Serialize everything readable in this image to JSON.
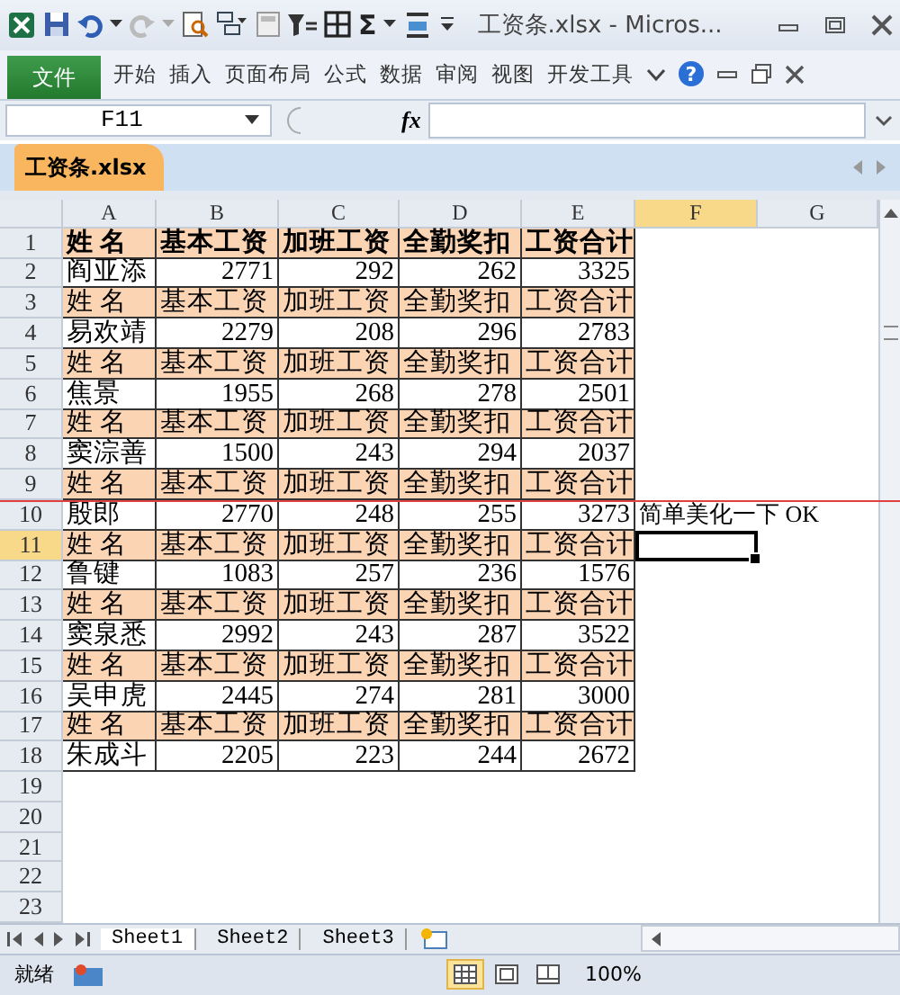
{
  "window": {
    "title": "工资条.xlsx - Micros..."
  },
  "quick_access": {
    "sum_symbol": "Σ"
  },
  "ribbon": {
    "file_tab": "文件",
    "tabs": [
      "开始",
      "插入",
      "页面布局",
      "公式",
      "数据",
      "审阅",
      "视图",
      "开发工具"
    ],
    "help": "?"
  },
  "formula_bar": {
    "name_box": "F11",
    "function_label": "fx"
  },
  "workbook_tab": {
    "label": "工资条.xlsx"
  },
  "columns": [
    {
      "label": "A",
      "selected": false
    },
    {
      "label": "B",
      "selected": false
    },
    {
      "label": "C",
      "selected": false
    },
    {
      "label": "D",
      "selected": false
    },
    {
      "label": "E",
      "selected": false
    },
    {
      "label": "F",
      "selected": true
    },
    {
      "label": "G",
      "selected": false
    }
  ],
  "rows": [
    {
      "number": "1",
      "kind": "title",
      "selected": false,
      "cells": [
        "姓 名",
        "基本工资",
        "加班工资",
        "全勤奖扣",
        "工资合计"
      ]
    },
    {
      "number": "2",
      "kind": "data",
      "selected": false,
      "cells": [
        "阎亚添",
        "2771",
        "292",
        "262",
        "3325"
      ]
    },
    {
      "number": "3",
      "kind": "header",
      "selected": false,
      "cells": [
        "姓 名",
        "基本工资",
        "加班工资",
        "全勤奖扣",
        "工资合计"
      ]
    },
    {
      "number": "4",
      "kind": "data",
      "selected": false,
      "cells": [
        "易欢靖",
        "2279",
        "208",
        "296",
        "2783"
      ]
    },
    {
      "number": "5",
      "kind": "header",
      "selected": false,
      "cells": [
        "姓 名",
        "基本工资",
        "加班工资",
        "全勤奖扣",
        "工资合计"
      ]
    },
    {
      "number": "6",
      "kind": "data",
      "selected": false,
      "cells": [
        "焦景",
        "1955",
        "268",
        "278",
        "2501"
      ]
    },
    {
      "number": "7",
      "kind": "header",
      "selected": false,
      "cells": [
        "姓 名",
        "基本工资",
        "加班工资",
        "全勤奖扣",
        "工资合计"
      ]
    },
    {
      "number": "8",
      "kind": "data",
      "selected": false,
      "cells": [
        "窦淙善",
        "1500",
        "243",
        "294",
        "2037"
      ]
    },
    {
      "number": "9",
      "kind": "header",
      "selected": false,
      "cells": [
        "姓 名",
        "基本工资",
        "加班工资",
        "全勤奖扣",
        "工资合计"
      ]
    },
    {
      "number": "10",
      "kind": "data",
      "selected": false,
      "cells": [
        "殷郎",
        "2770",
        "248",
        "255",
        "3273"
      ],
      "note": "简单美化一下 OK"
    },
    {
      "number": "11",
      "kind": "header",
      "selected": true,
      "cells": [
        "姓 名",
        "基本工资",
        "加班工资",
        "全勤奖扣",
        "工资合计"
      ]
    },
    {
      "number": "12",
      "kind": "data",
      "selected": false,
      "cells": [
        "鲁键",
        "1083",
        "257",
        "236",
        "1576"
      ]
    },
    {
      "number": "13",
      "kind": "header",
      "selected": false,
      "cells": [
        "姓 名",
        "基本工资",
        "加班工资",
        "全勤奖扣",
        "工资合计"
      ]
    },
    {
      "number": "14",
      "kind": "data",
      "selected": false,
      "cells": [
        "窦泉悉",
        "2992",
        "243",
        "287",
        "3522"
      ]
    },
    {
      "number": "15",
      "kind": "header",
      "selected": false,
      "cells": [
        "姓 名",
        "基本工资",
        "加班工资",
        "全勤奖扣",
        "工资合计"
      ]
    },
    {
      "number": "16",
      "kind": "data",
      "selected": false,
      "cells": [
        "吴申虎",
        "2445",
        "274",
        "281",
        "3000"
      ]
    },
    {
      "number": "17",
      "kind": "header",
      "selected": false,
      "cells": [
        "姓 名",
        "基本工资",
        "加班工资",
        "全勤奖扣",
        "工资合计"
      ]
    },
    {
      "number": "18",
      "kind": "data",
      "selected": false,
      "cells": [
        "朱成斗",
        "2205",
        "223",
        "244",
        "2672"
      ]
    },
    {
      "number": "19",
      "kind": "empty",
      "selected": false
    },
    {
      "number": "20",
      "kind": "empty",
      "selected": false
    },
    {
      "number": "21",
      "kind": "empty",
      "selected": false
    },
    {
      "number": "22",
      "kind": "empty",
      "selected": false
    },
    {
      "number": "23",
      "kind": "empty",
      "selected": false
    }
  ],
  "sheet_tabs": [
    {
      "label": "Sheet1",
      "selected": true
    },
    {
      "label": "Sheet2",
      "selected": false
    },
    {
      "label": "Sheet3",
      "selected": false
    }
  ],
  "status_bar": {
    "status": "就绪",
    "view_buttons": [
      {
        "kind": "normal",
        "selected": true
      },
      {
        "kind": "layout",
        "selected": false
      },
      {
        "kind": "pagebreak",
        "selected": false
      }
    ],
    "zoom": "100%"
  }
}
